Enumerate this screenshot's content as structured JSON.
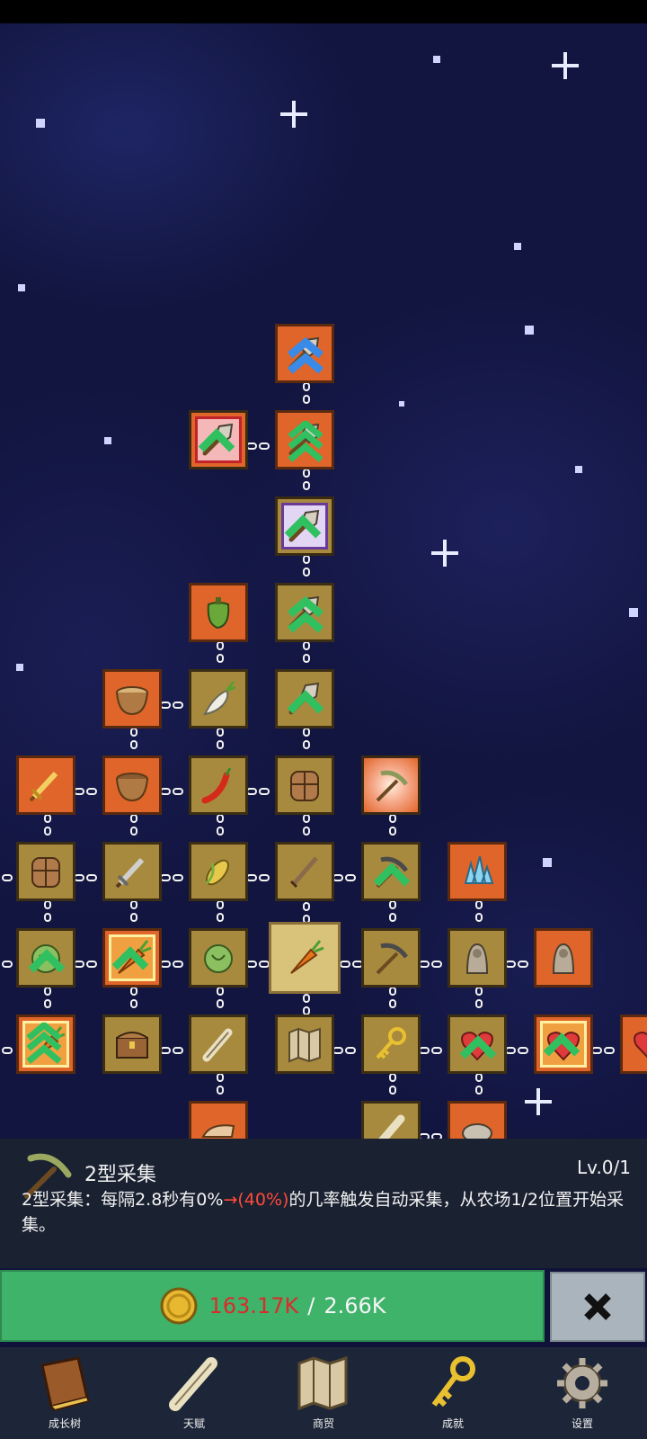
{
  "tree": {
    "nodes": [
      {
        "id": "shovel-top",
        "icon": "shovel-icon",
        "style": "orange",
        "upgrade": "double-arrow-blue"
      },
      {
        "id": "shovel-red",
        "icon": "shovel-icon",
        "style": "pink",
        "upgrade": "arrow-green"
      },
      {
        "id": "shovel-2",
        "icon": "shovel-icon",
        "style": "orange",
        "upgrade": "triple-arrow-green"
      },
      {
        "id": "shovel-purple",
        "icon": "shovel-icon",
        "style": "purple",
        "upgrade": "arrow-green"
      },
      {
        "id": "pepper",
        "icon": "pepper-icon",
        "style": "orange"
      },
      {
        "id": "shovel-3",
        "icon": "shovel-icon",
        "style": "gold",
        "upgrade": "double-arrow-green"
      },
      {
        "id": "bowl-top",
        "icon": "bowl-icon",
        "style": "orange"
      },
      {
        "id": "radish",
        "icon": "radish-icon",
        "style": "gold"
      },
      {
        "id": "shovel-4",
        "icon": "shovel-icon",
        "style": "gold",
        "upgrade": "arrow-green"
      },
      {
        "id": "sword-orange",
        "icon": "sword-icon",
        "style": "orange"
      },
      {
        "id": "bowl",
        "icon": "bowl-icon",
        "style": "orange"
      },
      {
        "id": "chili",
        "icon": "chili-icon",
        "style": "gold"
      },
      {
        "id": "backpack",
        "icon": "backpack-icon",
        "style": "gold"
      },
      {
        "id": "pickaxe-burst",
        "icon": "pickaxe-icon",
        "style": "burst"
      }
    ]
  },
  "skill": {
    "name": "2型采集",
    "level": "Lv.0/1",
    "desc_pre": "2型采集：每隔2.8秒有0%",
    "desc_arrow": "→(40%)",
    "desc_post": "的几率触发自动采集，从农场1/2位置开始采集。"
  },
  "purchase": {
    "have": "163.17K",
    "sep": "/",
    "need": "2.66K"
  },
  "nav": [
    {
      "label": "成长树",
      "icon": "book-icon"
    },
    {
      "label": "天赋",
      "icon": "scroll-icon"
    },
    {
      "label": "商贸",
      "icon": "map-icon"
    },
    {
      "label": "成就",
      "icon": "key-icon"
    },
    {
      "label": "设置",
      "icon": "gear-icon"
    }
  ],
  "colors": {
    "sky": "#12153f",
    "node_orange": "#e0652a",
    "node_gold": "#a88a3e",
    "buy_green": "#3fb36a",
    "cost_red": "#d92c2c",
    "panel": "#1a2131"
  }
}
